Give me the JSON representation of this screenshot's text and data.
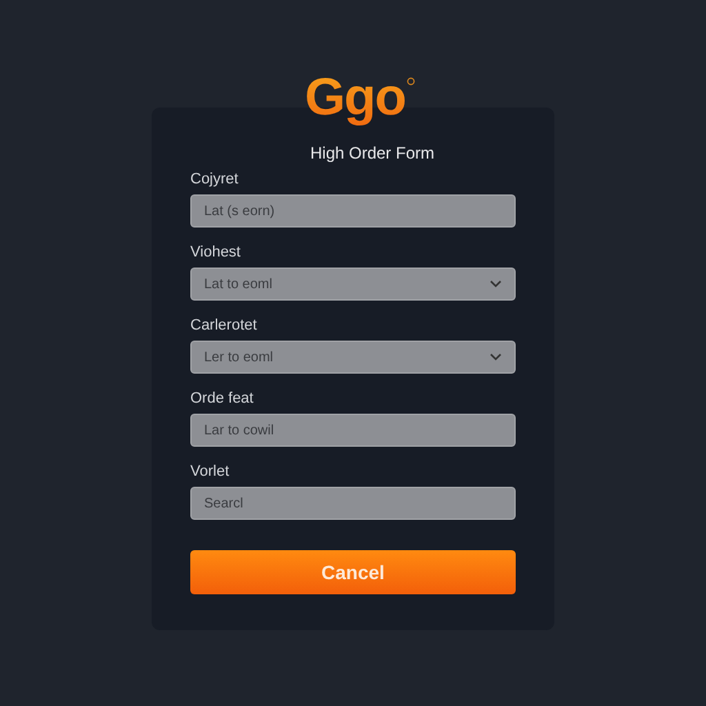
{
  "logo": "Ggo",
  "title": "High Order Form",
  "fields": [
    {
      "label": "Cojyret",
      "kind": "text",
      "placeholder": "Lat (s eorn)"
    },
    {
      "label": "Viohest",
      "kind": "select",
      "placeholder": "Lat to eoml"
    },
    {
      "label": "Carlerotet",
      "kind": "select",
      "placeholder": "Ler to eoml"
    },
    {
      "label": "Orde feat",
      "kind": "text",
      "placeholder": "Lar to cowil"
    },
    {
      "label": "Vorlet",
      "kind": "text",
      "placeholder": "Searcl"
    }
  ],
  "button": "Cancel"
}
